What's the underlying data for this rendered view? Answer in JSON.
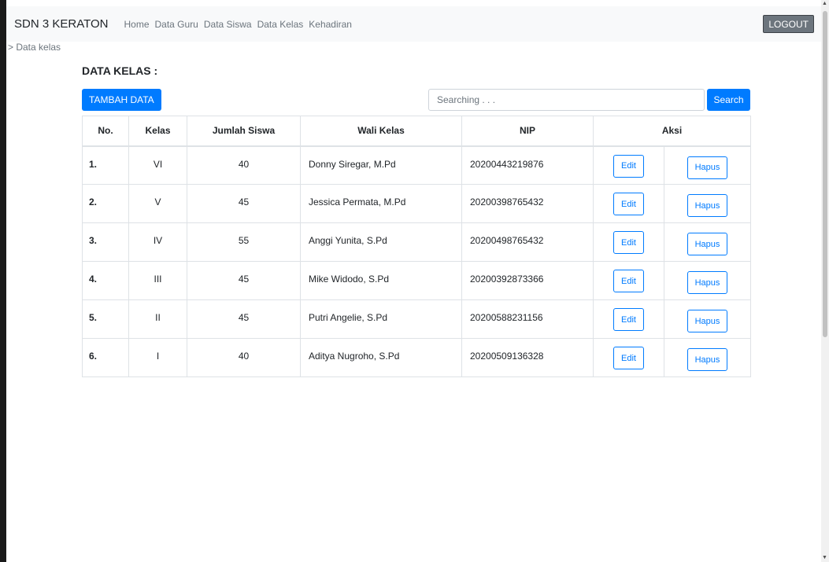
{
  "navbar": {
    "brand": "SDN 3 KERATON",
    "links": [
      "Home",
      "Data Guru",
      "Data Siswa",
      "Data Kelas",
      "Kehadiran"
    ],
    "logout_label": "LOGOUT"
  },
  "breadcrumb": "> Data kelas",
  "page_title": "DATA KELAS :",
  "toolbar": {
    "add_label": "TAMBAH DATA",
    "search_placeholder": "Searching . . .",
    "search_label": "Search"
  },
  "table": {
    "headers": [
      "No.",
      "Kelas",
      "Jumlah Siswa",
      "Wali Kelas",
      "NIP",
      "Aksi"
    ],
    "rows": [
      {
        "no": "1.",
        "kelas": "VI",
        "jumlah": "40",
        "wali": "Donny Siregar, M.Pd",
        "nip": "20200443219876",
        "edit": "Edit",
        "hapus": "Hapus"
      },
      {
        "no": "2.",
        "kelas": "V",
        "jumlah": "45",
        "wali": "Jessica Permata, M.Pd",
        "nip": "20200398765432",
        "edit": "Edit",
        "hapus": "Hapus"
      },
      {
        "no": "3.",
        "kelas": "IV",
        "jumlah": "55",
        "wali": "Anggi Yunita, S.Pd",
        "nip": "20200498765432",
        "edit": "Edit",
        "hapus": "Hapus"
      },
      {
        "no": "4.",
        "kelas": "III",
        "jumlah": "45",
        "wali": "Mike Widodo, S.Pd",
        "nip": "20200392873366",
        "edit": "Edit",
        "hapus": "Hapus"
      },
      {
        "no": "5.",
        "kelas": "II",
        "jumlah": "45",
        "wali": "Putri Angelie, S.Pd",
        "nip": "20200588231156",
        "edit": "Edit",
        "hapus": "Hapus"
      },
      {
        "no": "6.",
        "kelas": "I",
        "jumlah": "40",
        "wali": "Aditya Nugroho, S.Pd",
        "nip": "20200509136328",
        "edit": "Edit",
        "hapus": "Hapus"
      }
    ]
  },
  "colors": {
    "primary": "#007bff",
    "navbar_bg": "#f8f9fa",
    "logout_bg": "#6c757d"
  }
}
